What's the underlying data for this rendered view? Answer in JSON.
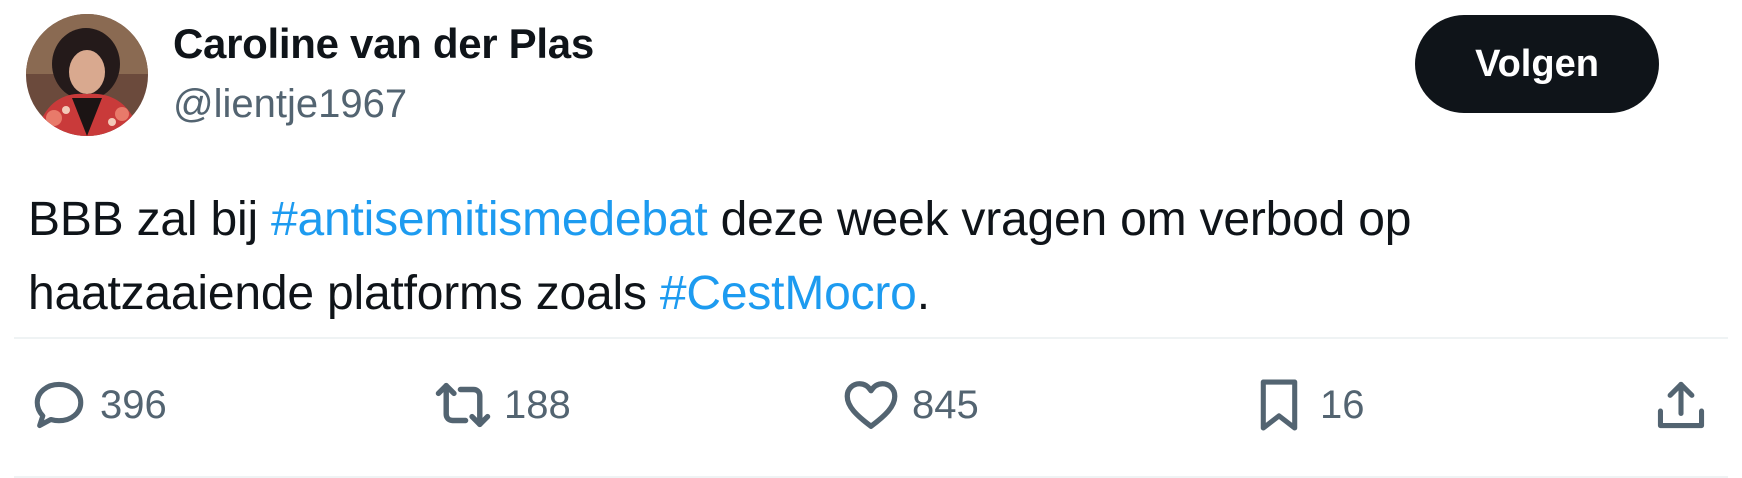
{
  "author": {
    "display_name": "Caroline van der Plas",
    "handle": "@lientje1967"
  },
  "follow_button": {
    "label": "Volgen"
  },
  "tweet": {
    "text_part1": "BBB zal bij ",
    "hashtag1": "#antisemitismedebat",
    "text_part2": " deze week vragen om verbod op haatzaaiende platforms zoals ",
    "hashtag2": "#CestMocro",
    "text_part3": "."
  },
  "actions": {
    "replies": "396",
    "reposts": "188",
    "likes": "845",
    "bookmarks": "16"
  },
  "icons": {
    "reply": "speech-bubble-icon",
    "repost": "repost-arrows-icon",
    "like": "heart-icon",
    "bookmark": "bookmark-icon",
    "share": "share-upload-icon"
  },
  "colors": {
    "text": "#0f1419",
    "secondary": "#536471",
    "link": "#1d9bf0",
    "button_bg": "#0f1419",
    "button_text": "#ffffff",
    "divider": "#eff3f4"
  }
}
